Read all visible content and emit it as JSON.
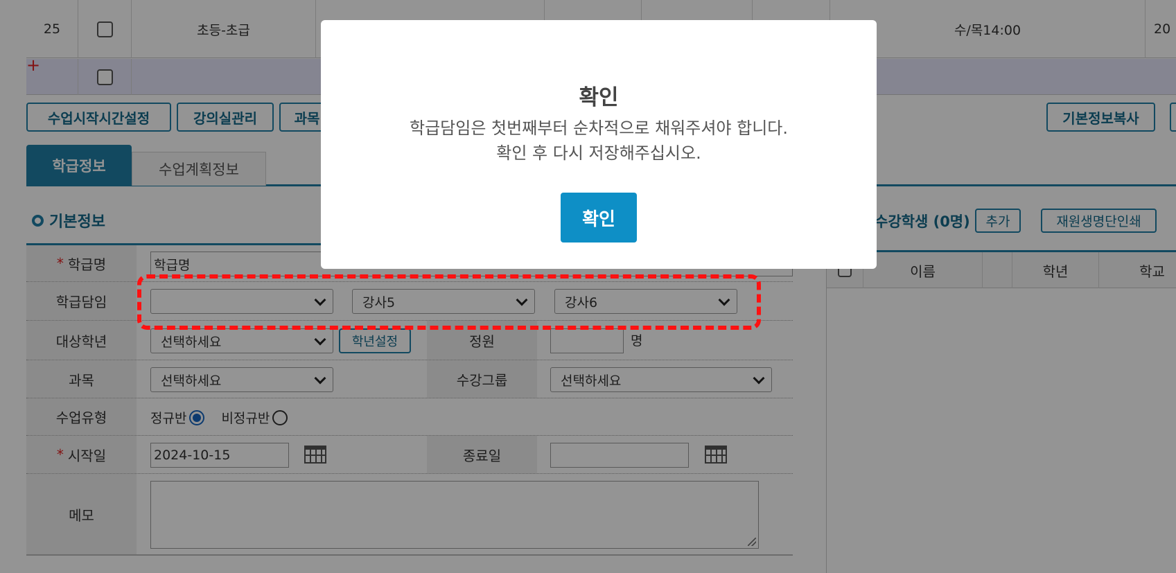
{
  "table": {
    "row25": {
      "no": "25",
      "level": "초등-초급",
      "col3": "수/목14:00",
      "col4": "20"
    }
  },
  "toolbar": {
    "class_start_time": "수업시작시간설정",
    "classroom_manage": "강의실관리",
    "subject": "과목",
    "copy_basic_info": "기본정보복사"
  },
  "tabs": {
    "class_info": "학급정보",
    "lesson_plan": "수업계획정보"
  },
  "section": {
    "basic_info": "기본정보"
  },
  "form": {
    "class_name_label": "학급명",
    "class_name_value": "학급명",
    "homeroom_label": "학급담임",
    "homeroom_1": "",
    "homeroom_2": "강사5",
    "homeroom_3": "강사6",
    "target_grade_label": "대상학년",
    "target_grade_value": "선택하세요",
    "grade_setting_button": "학년설정",
    "capacity_label": "정원",
    "capacity_value": "",
    "capacity_unit": "명",
    "subject_label": "과목",
    "subject_value": "선택하세요",
    "course_group_label": "수강그룹",
    "course_group_value": "선택하세요",
    "class_type_label": "수업유형",
    "class_type_regular": "정규반",
    "class_type_irregular": "비정규반",
    "start_date_label": "시작일",
    "start_date_value": "2024-10-15",
    "end_date_label": "종료일",
    "end_date_value": "",
    "memo_label": "메모",
    "required_mark": "*"
  },
  "right_panel": {
    "students_title": "수강학생 (0명)",
    "add_button": "추가",
    "print_roster_button": "재원생명단인쇄",
    "col_name": "이름",
    "col_grade": "학년",
    "col_school": "학교"
  },
  "modal": {
    "title": "확인",
    "message_line1": "학급담임은 첫번째부터 순차적으로 채워주셔야 합니다.",
    "message_line2": "확인 후 다시 저장해주십시오.",
    "confirm_button": "확인"
  },
  "colors": {
    "accent": "#1f7fa6",
    "modal_button": "#0e8fc6",
    "highlight": "#ff1111",
    "new_row": "#e6e6fa"
  }
}
